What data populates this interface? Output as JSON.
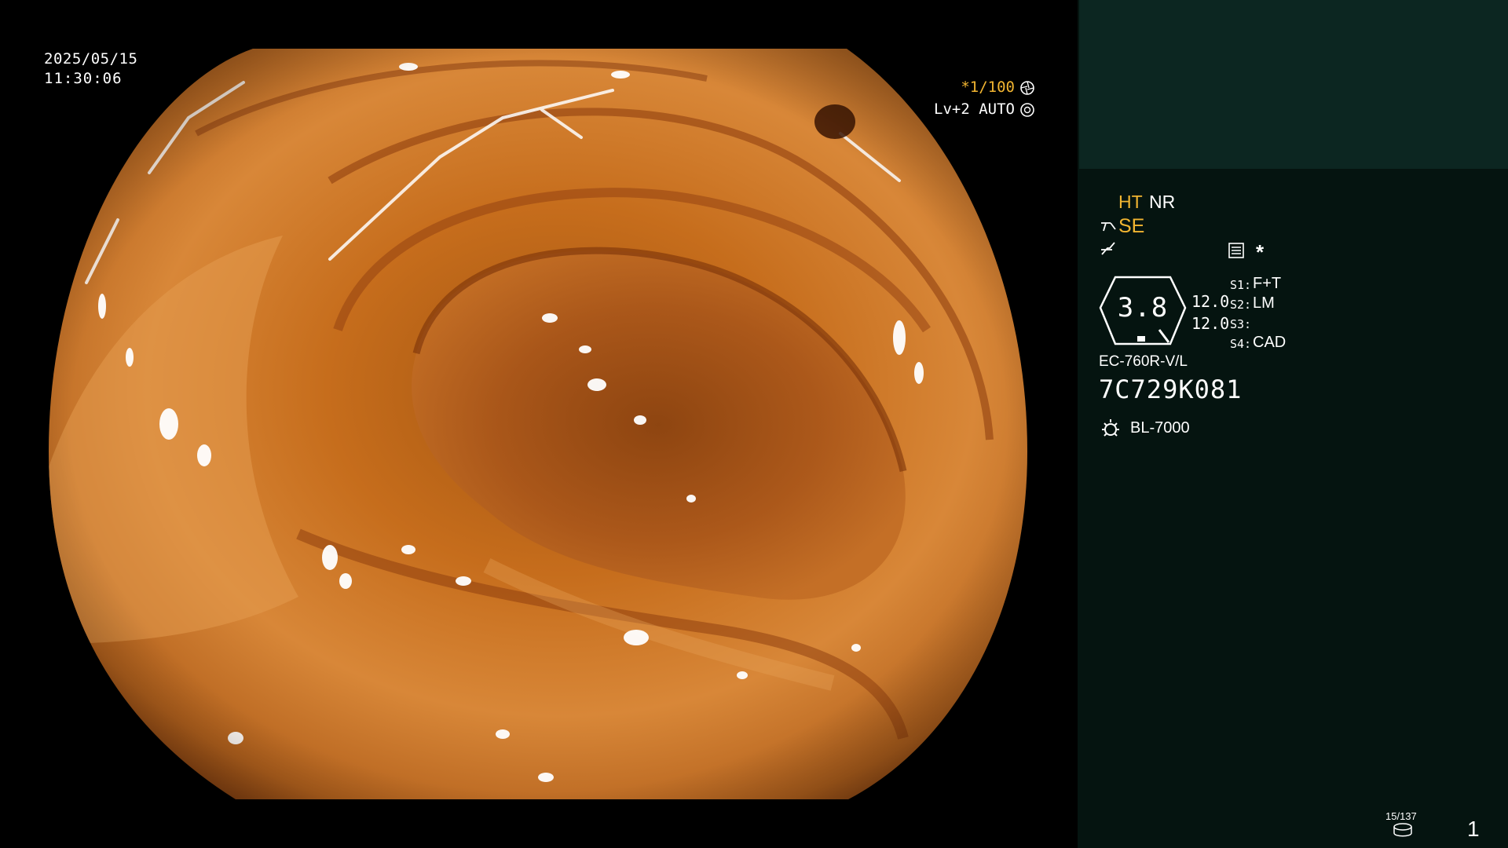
{
  "overlay": {
    "date": "2025/05/15",
    "time": "11:30:06",
    "shutter_speed": "*1/100",
    "level": "Lv+2 AUTO"
  },
  "panel": {
    "mode_ht": "HT",
    "mode_nr": "NR",
    "mode_se": "SE",
    "star": "*",
    "zoom_value": "3.8",
    "val_top": "12.0",
    "val_bottom": "12.0",
    "s1_key": "S1:",
    "s1_value": "F+T",
    "s2_key": "S2:",
    "s2_value": "LM",
    "s3_key": "S3:",
    "s3_value": "",
    "s4_key": "S4:",
    "s4_value": "CAD",
    "scope_model": "EC-760R-V/L",
    "serial_number": "7C729K081",
    "light_source": "BL-7000",
    "record_count": "15/137",
    "page_number": "1"
  },
  "colors": {
    "panel_background": "#051410",
    "panel_top_background": "#0c2621",
    "highlight_yellow": "#f2b531"
  },
  "icons": {
    "shutter": "aperture-icon",
    "level": "auto-exposure-icon",
    "se": "enhancement-icon",
    "curve": "tone-curve-icon",
    "structure": "structure-enhancement-icon",
    "light": "light-source-icon",
    "storage": "storage-disk-icon"
  }
}
